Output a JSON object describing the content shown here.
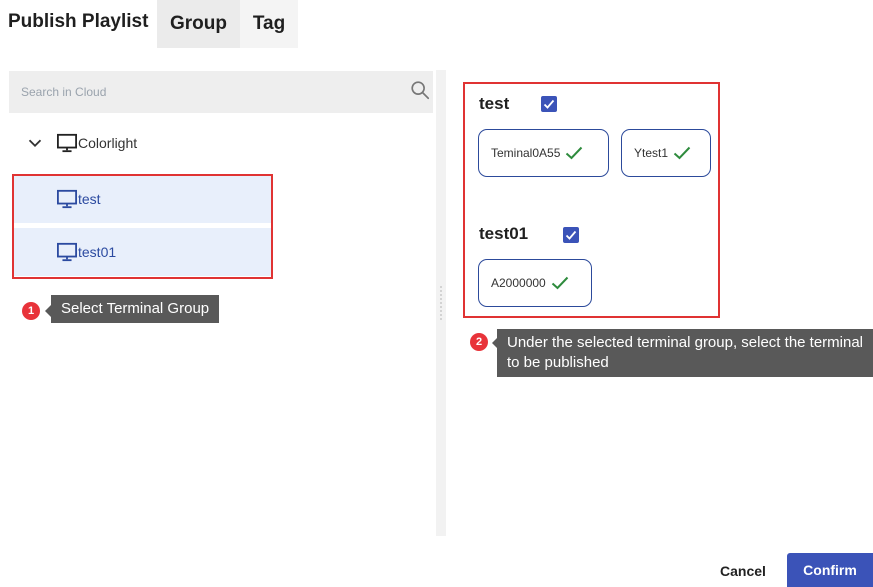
{
  "header": {
    "title": "Publish Playlist",
    "tabs": [
      {
        "label": "Group",
        "active": true
      },
      {
        "label": "Tag",
        "active": false
      }
    ]
  },
  "search": {
    "placeholder": "Search in Cloud",
    "icon": "search-icon"
  },
  "tree": {
    "root": {
      "label": "Colorlight",
      "icon": "monitor-icon",
      "expanded": true
    },
    "groups": [
      {
        "label": "test",
        "icon": "monitor-icon",
        "selected": true
      },
      {
        "label": "test01",
        "icon": "monitor-icon",
        "selected": true
      }
    ]
  },
  "tips": [
    {
      "step": "1",
      "text": "Select Terminal Group"
    },
    {
      "step": "2",
      "text": "Under the selected terminal group, select the terminal to be published"
    }
  ],
  "selection": {
    "groups": [
      {
        "name": "test",
        "checked": true,
        "terminals": [
          {
            "name": "Teminal0A55",
            "selected": true
          },
          {
            "name": "Ytest1",
            "selected": true
          }
        ]
      },
      {
        "name": "test01",
        "checked": true,
        "terminals": [
          {
            "name": "A2000000",
            "selected": true
          }
        ]
      }
    ]
  },
  "footer": {
    "cancel_label": "Cancel",
    "confirm_label": "Confirm"
  },
  "colors": {
    "accent": "#3b53b8",
    "highlight_frame": "#e03333",
    "selected_row_bg": "#e8effb",
    "check_green": "#2e8b3d",
    "tooltip_bg": "#595959",
    "step_badge": "#e8333a"
  }
}
